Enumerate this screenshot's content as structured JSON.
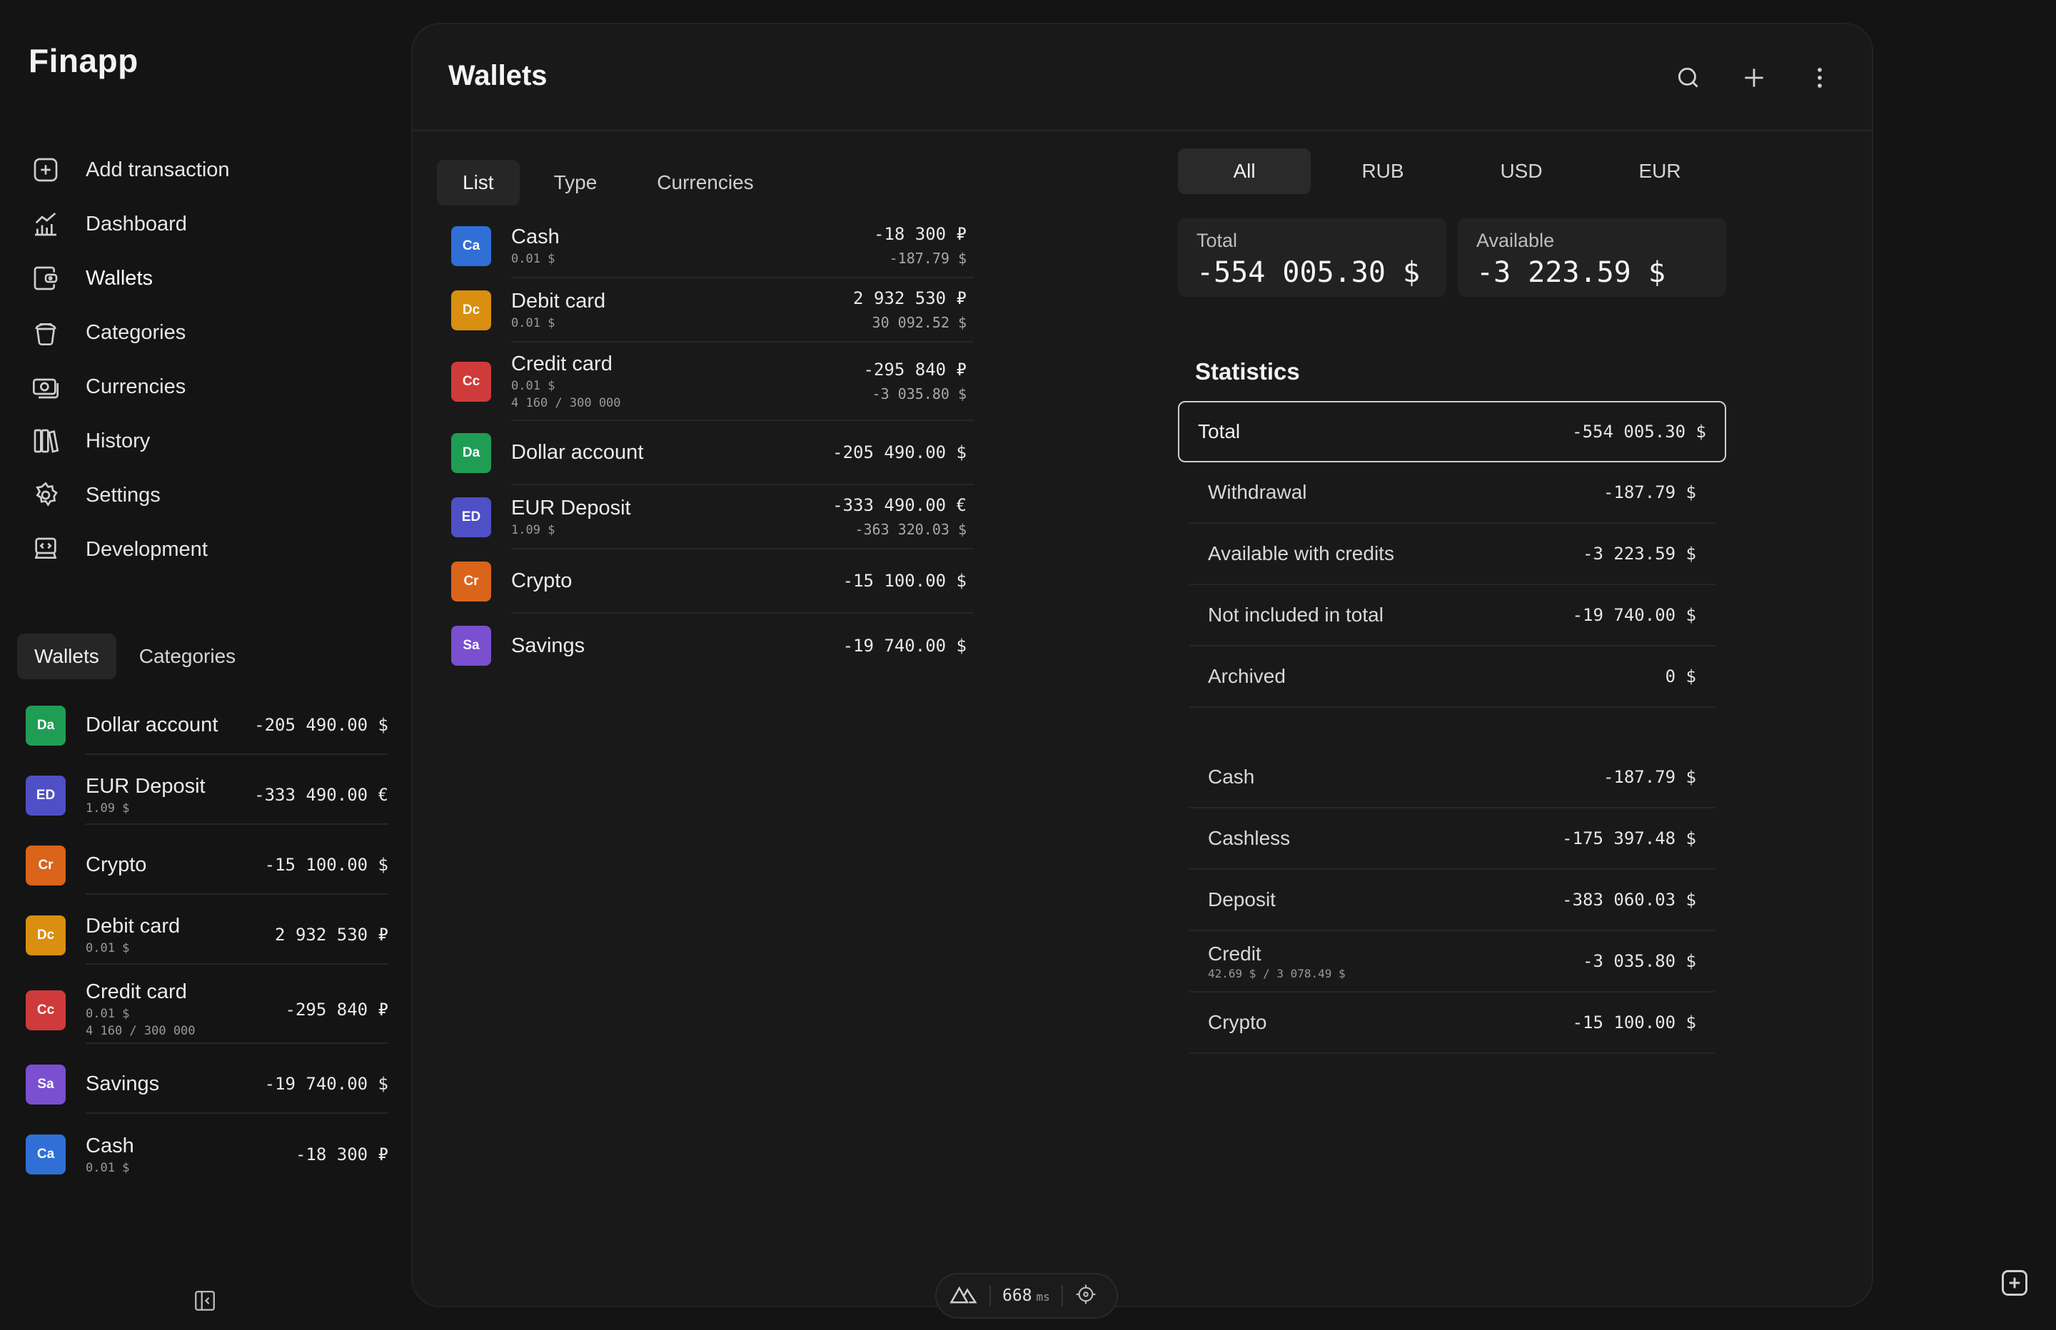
{
  "app": {
    "title": "Finapp"
  },
  "nav": {
    "items": [
      {
        "label": "Add transaction",
        "icon": "plus-square-icon"
      },
      {
        "label": "Dashboard",
        "icon": "chart-icon"
      },
      {
        "label": "Wallets",
        "icon": "wallet-icon"
      },
      {
        "label": "Categories",
        "icon": "categories-icon"
      },
      {
        "label": "Currencies",
        "icon": "currencies-icon"
      },
      {
        "label": "History",
        "icon": "history-icon"
      },
      {
        "label": "Settings",
        "icon": "gear-icon"
      },
      {
        "label": "Development",
        "icon": "development-icon"
      }
    ],
    "active": "Wallets"
  },
  "sidebar": {
    "tabs": [
      "Wallets",
      "Categories"
    ],
    "wallets": [
      {
        "abbr": "Da",
        "color": "#1f9d55",
        "name": "Dollar account",
        "sub": "",
        "sub2": "",
        "amount": "-205 490.00 $"
      },
      {
        "abbr": "ED",
        "color": "#4f4fc6",
        "name": "EUR Deposit",
        "sub": "1.09 $",
        "sub2": "",
        "amount": "-333 490.00 €"
      },
      {
        "abbr": "Cr",
        "color": "#d9641a",
        "name": "Crypto",
        "sub": "",
        "sub2": "",
        "amount": "-15 100.00 $"
      },
      {
        "abbr": "Dc",
        "color": "#d98f10",
        "name": "Debit card",
        "sub": "0.01 $",
        "sub2": "",
        "amount": "2 932 530 ₽"
      },
      {
        "abbr": "Cc",
        "color": "#cf3a3a",
        "name": "Credit card",
        "sub": "0.01 $",
        "sub2": "4 160 / 300 000",
        "amount": "-295 840 ₽"
      },
      {
        "abbr": "Sa",
        "color": "#7a4fd0",
        "name": "Savings",
        "sub": "",
        "sub2": "",
        "amount": "-19 740.00 $"
      },
      {
        "abbr": "Ca",
        "color": "#2f6fd6",
        "name": "Cash",
        "sub": "0.01 $",
        "sub2": "",
        "amount": "-18 300 ₽"
      }
    ]
  },
  "main": {
    "title": "Wallets",
    "list_tabs": [
      "List",
      "Type",
      "Currencies"
    ],
    "wallets": [
      {
        "abbr": "Ca",
        "color": "#2f6fd6",
        "name": "Cash",
        "sub": "0.01 $",
        "sub2": "",
        "amount": "-18 300 ₽",
        "amount2": "-187.79 $"
      },
      {
        "abbr": "Dc",
        "color": "#d98f10",
        "name": "Debit card",
        "sub": "0.01 $",
        "sub2": "",
        "amount": "2 932 530 ₽",
        "amount2": "30 092.52 $"
      },
      {
        "abbr": "Cc",
        "color": "#cf3a3a",
        "name": "Credit card",
        "sub": "0.01 $",
        "sub2": "4 160 / 300 000",
        "amount": "-295 840 ₽",
        "amount2": "-3 035.80 $"
      },
      {
        "abbr": "Da",
        "color": "#1f9d55",
        "name": "Dollar account",
        "sub": "",
        "sub2": "",
        "amount": "-205 490.00 $",
        "amount2": ""
      },
      {
        "abbr": "ED",
        "color": "#4f4fc6",
        "name": "EUR Deposit",
        "sub": "1.09 $",
        "sub2": "",
        "amount": "-333 490.00 €",
        "amount2": "-363 320.03 $"
      },
      {
        "abbr": "Cr",
        "color": "#d9641a",
        "name": "Crypto",
        "sub": "",
        "sub2": "",
        "amount": "-15 100.00 $",
        "amount2": ""
      },
      {
        "abbr": "Sa",
        "color": "#7a4fd0",
        "name": "Savings",
        "sub": "",
        "sub2": "",
        "amount": "-19 740.00 $",
        "amount2": ""
      }
    ],
    "currency_tabs": [
      "All",
      "RUB",
      "USD",
      "EUR"
    ],
    "summary": {
      "total_label": "Total",
      "total_value": "-554 005.30 $",
      "available_label": "Available",
      "available_value": "-3 223.59 $"
    },
    "statistics_title": "Statistics",
    "stats": [
      {
        "label": "Total",
        "value": "-554 005.30 $"
      },
      {
        "label": "Withdrawal",
        "value": "-187.79 $"
      },
      {
        "label": "Available with credits",
        "value": "-3 223.59 $"
      },
      {
        "label": "Not included in total",
        "value": "-19 740.00 $"
      },
      {
        "label": "Archived",
        "value": "0 $"
      }
    ],
    "stats_types": [
      {
        "label": "Cash",
        "sub": "",
        "value": "-187.79 $"
      },
      {
        "label": "Cashless",
        "sub": "",
        "value": "-175 397.48 $"
      },
      {
        "label": "Deposit",
        "sub": "",
        "value": "-383 060.03 $"
      },
      {
        "label": "Credit",
        "sub": "42.69 $ / 3 078.49 $",
        "value": "-3 035.80 $"
      },
      {
        "label": "Crypto",
        "sub": "",
        "value": "-15 100.00 $"
      }
    ]
  },
  "devbar": {
    "ms": "668",
    "unit": "ms"
  }
}
